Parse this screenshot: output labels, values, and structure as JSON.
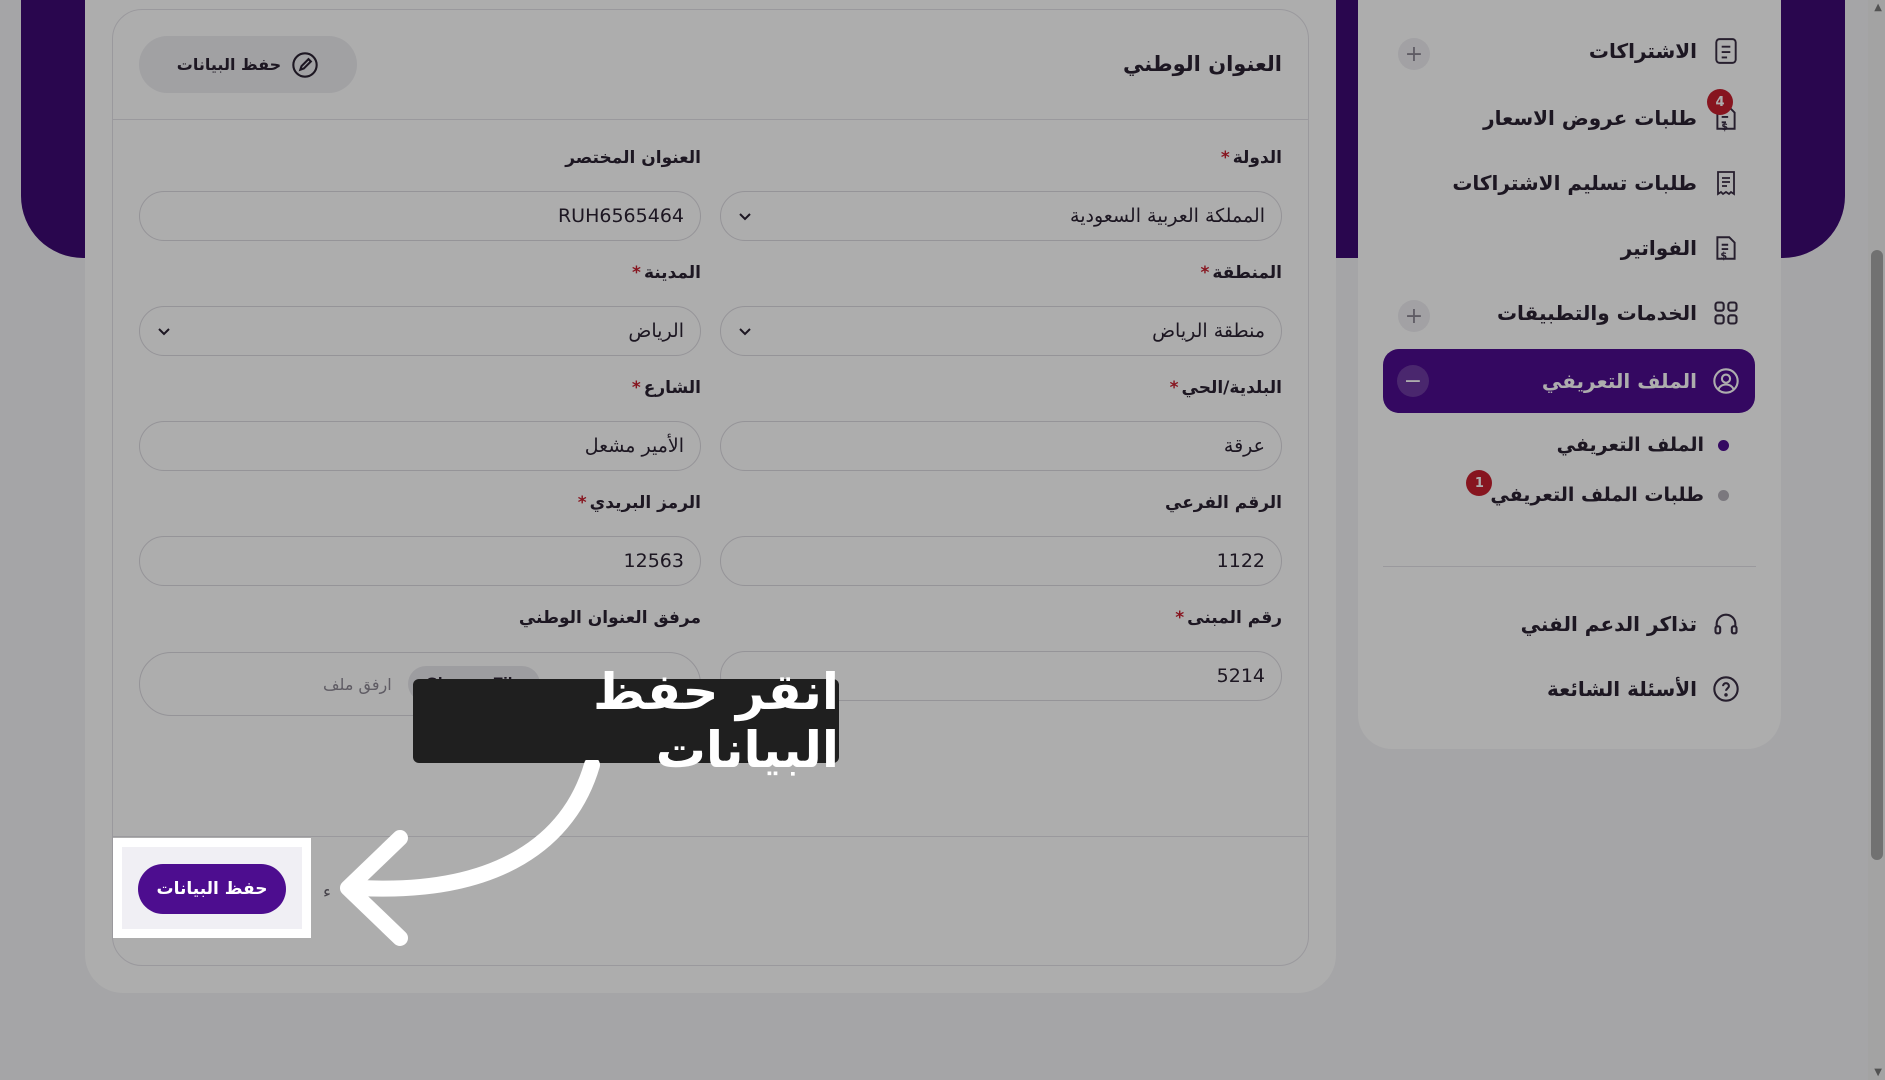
{
  "form": {
    "section_title": "العنوان الوطني",
    "header_save_label": "حفظ البيانات",
    "fields": {
      "country": {
        "label": "الدولة",
        "value": "المملكة العربية السعودية"
      },
      "short_address": {
        "label": "العنوان المختصر",
        "value": "RUH6565464"
      },
      "region": {
        "label": "المنطقة",
        "value": "منطقة الرياض"
      },
      "city": {
        "label": "المدينة",
        "value": "الرياض"
      },
      "district": {
        "label": "البلدية/الحي",
        "value": "عرقة"
      },
      "street": {
        "label": "الشارع",
        "value": "الأمير مشعل"
      },
      "secondary_number": {
        "label": "الرقم الفرعي",
        "value": "1122"
      },
      "postal_code": {
        "label": "الرمز البريدي",
        "value": "12563"
      },
      "building_number": {
        "label": "رقم المبنى",
        "value": "5214"
      },
      "attachment": {
        "label": "مرفق العنوان الوطني",
        "button": "Choose File",
        "placeholder": "ارفق ملف"
      }
    },
    "required_mark": "*",
    "footer": {
      "save_label": "حفظ البيانات",
      "cancel_label": "ء"
    }
  },
  "sidebar": {
    "items": [
      {
        "label": "الاشتراكات",
        "icon": "document-icon"
      },
      {
        "label": "طلبات عروض الاسعار",
        "icon": "quote-dollar-icon",
        "badge": "4"
      },
      {
        "label": "طلبات تسليم الاشتراكات",
        "icon": "receipt-icon"
      },
      {
        "label": "الفواتير",
        "icon": "invoice-dollar-icon"
      },
      {
        "label": "الخدمات والتطبيقات",
        "icon": "grid-icon"
      },
      {
        "label": "الملف التعريفي",
        "icon": "user-circle-icon",
        "active": true
      }
    ],
    "sub_items": [
      {
        "label": "الملف التعريفي"
      },
      {
        "label": "طلبات الملف التعريفي",
        "badge": "1"
      }
    ],
    "bottom_items": [
      {
        "label": "تذاكر الدعم الفني",
        "icon": "headset-icon"
      },
      {
        "label": "الأسئلة الشائعة",
        "icon": "question-icon"
      }
    ]
  },
  "tutorial": {
    "tooltip": "انقر حفظ البيانات"
  },
  "colors": {
    "primary": "#4d0d8f",
    "badge": "#c81f2f",
    "header_band": "#3d0a73"
  }
}
